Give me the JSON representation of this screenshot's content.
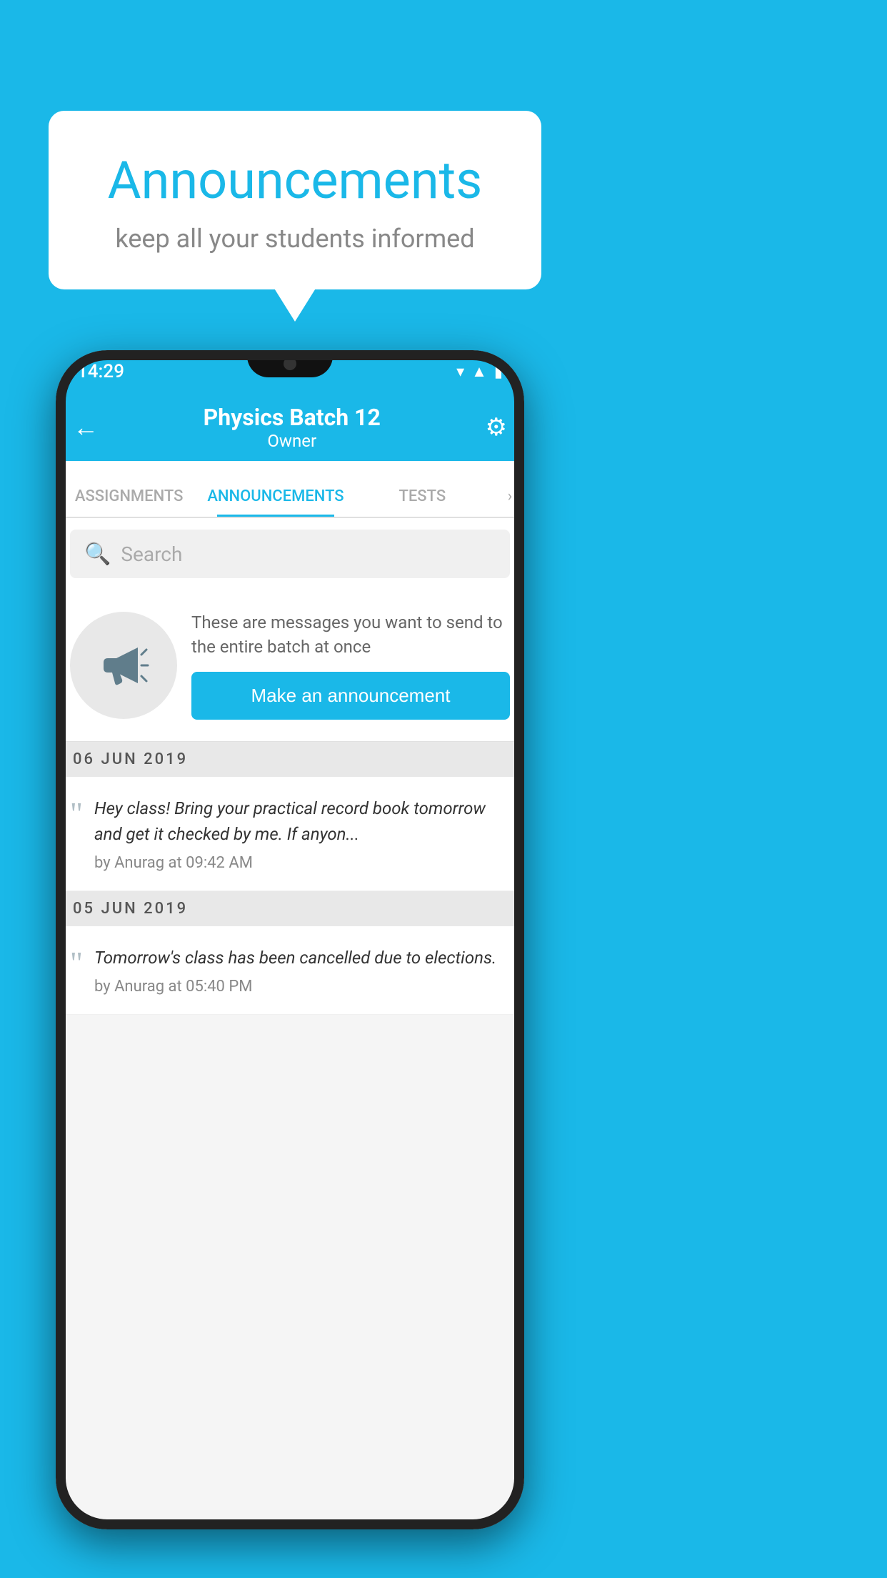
{
  "background_color": "#1ab8e8",
  "speech_bubble": {
    "title": "Announcements",
    "subtitle": "keep all your students informed"
  },
  "phone": {
    "status_bar": {
      "time": "14:29",
      "icons": [
        "wifi",
        "signal",
        "battery"
      ]
    },
    "header": {
      "title": "Physics Batch 12",
      "subtitle": "Owner",
      "back_label": "←",
      "gear_label": "⚙"
    },
    "tabs": [
      {
        "label": "ASSIGNMENTS",
        "active": false
      },
      {
        "label": "ANNOUNCEMENTS",
        "active": true
      },
      {
        "label": "TESTS",
        "active": false
      }
    ],
    "tabs_more": "›",
    "search": {
      "placeholder": "Search"
    },
    "promo": {
      "text": "These are messages you want to send to the entire batch at once",
      "button_label": "Make an announcement"
    },
    "announcements": [
      {
        "date": "06  JUN  2019",
        "text": "Hey class! Bring your practical record book tomorrow and get it checked by me. If anyon...",
        "meta": "by Anurag at 09:42 AM"
      },
      {
        "date": "05  JUN  2019",
        "text": "Tomorrow's class has been cancelled due to elections.",
        "meta": "by Anurag at 05:40 PM"
      }
    ]
  }
}
